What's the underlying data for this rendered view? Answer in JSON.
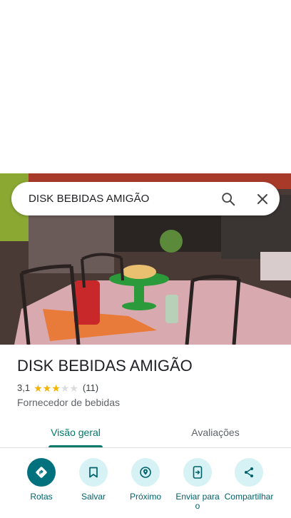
{
  "search": {
    "query": "DISK BEBIDAS AMIGÃO"
  },
  "place": {
    "name": "DISK BEBIDAS AMIGÃO",
    "rating": "3,1",
    "rating_stars": 3.1,
    "review_count": "(11)",
    "category": "Fornecedor de bebidas"
  },
  "tabs": [
    {
      "label": "Visão geral",
      "active": true
    },
    {
      "label": "Avaliações",
      "active": false
    }
  ],
  "actions": [
    {
      "label": "Rotas",
      "icon": "directions-icon",
      "primary": true
    },
    {
      "label": "Salvar",
      "icon": "bookmark-icon"
    },
    {
      "label": "Próximo",
      "icon": "nearby-icon"
    },
    {
      "label": "Enviar para o",
      "icon": "send-to-phone-icon"
    },
    {
      "label": "Compartilhar",
      "icon": "share-icon"
    }
  ],
  "colors": {
    "accent": "#00796b",
    "action_primary": "#00717d",
    "action_bg": "#d6f2f4",
    "star": "#f4b400",
    "star_empty": "#dadce0"
  }
}
